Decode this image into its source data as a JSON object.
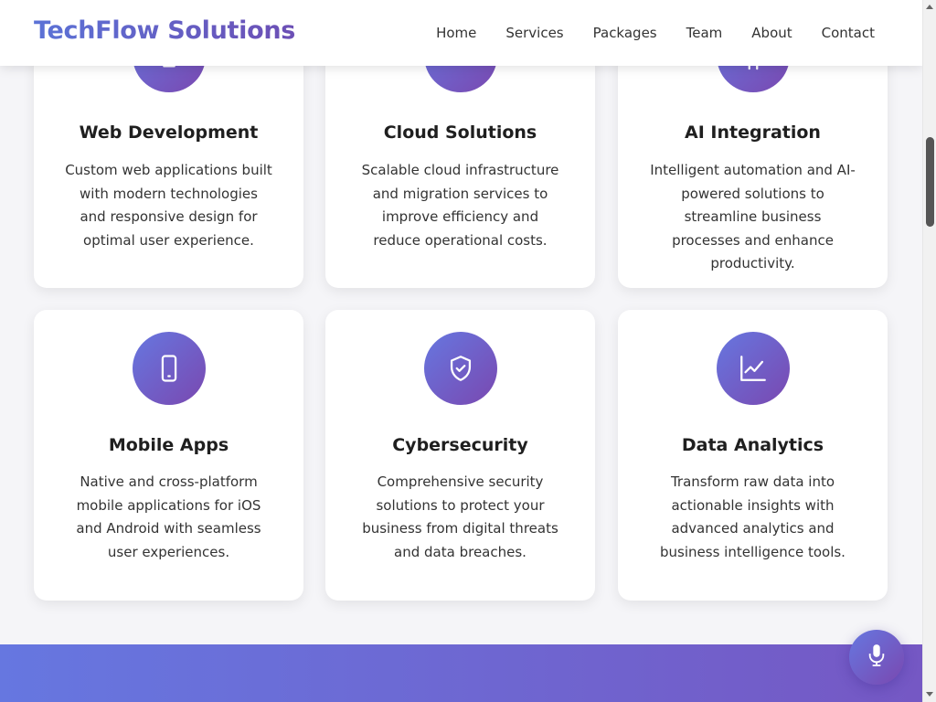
{
  "header": {
    "logo": "TechFlow Solutions",
    "nav": [
      "Home",
      "Services",
      "Packages",
      "Team",
      "About",
      "Contact"
    ]
  },
  "services": [
    {
      "title": "Web Development",
      "icon": "monitor-icon",
      "desc": "Custom web applications built with modern technologies and responsive design for optimal user experience."
    },
    {
      "title": "Cloud Solutions",
      "icon": "cloud-icon",
      "desc": "Scalable cloud infrastructure and migration services to improve efficiency and reduce operational costs."
    },
    {
      "title": "AI Integration",
      "icon": "chip-icon",
      "desc": "Intelligent automation and AI-powered solutions to streamline business processes and enhance productivity."
    },
    {
      "title": "Mobile Apps",
      "icon": "smartphone-icon",
      "desc": "Native and cross-platform mobile applications for iOS and Android with seamless user experiences."
    },
    {
      "title": "Cybersecurity",
      "icon": "shield-check-icon",
      "desc": "Comprehensive security solutions to protect your business from digital threats and data breaches."
    },
    {
      "title": "Data Analytics",
      "icon": "line-chart-icon",
      "desc": "Transform raw data into actionable insights with advanced analytics and business intelligence tools."
    }
  ],
  "voice_button": {
    "icon": "microphone-icon"
  },
  "colors": {
    "accent_start": "#6677e0",
    "accent_end": "#7a48b0"
  }
}
